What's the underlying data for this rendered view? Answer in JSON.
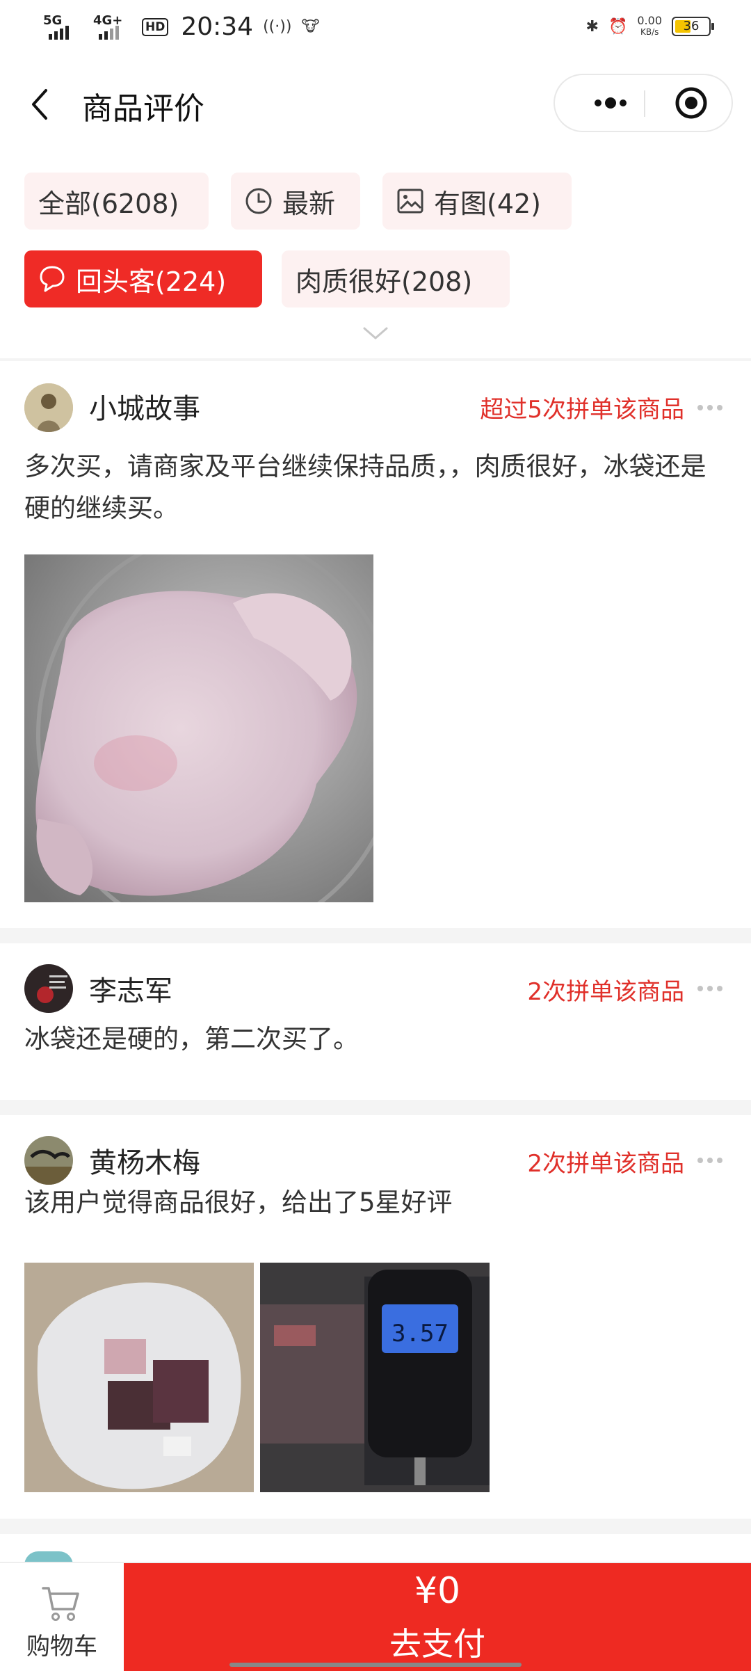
{
  "status_bar": {
    "net1": "5G",
    "net2": "4G+",
    "hd": "HD",
    "time": "20:34",
    "speed_value": "0.00",
    "speed_unit": "KB/s",
    "battery": "36"
  },
  "header": {
    "title": "商品评价"
  },
  "filters": {
    "all": "全部(6208)",
    "latest": "最新",
    "with_images": "有图(42)",
    "returning": "回头客(224)",
    "meat_quality": "肉质很好(208)"
  },
  "reviews": [
    {
      "username": "小城故事",
      "badge": "超过5次拼单该商品",
      "content": "多次买，请商家及平台继续保持品质，，肉质很好，冰袋还是硬的继续买。"
    },
    {
      "username": "李志军",
      "badge": "2次拼单该商品",
      "content": "冰袋还是硬的，第二次买了。"
    },
    {
      "username": "黄杨木梅",
      "badge": "2次拼单该商品",
      "content": "该用户觉得商品很好，给出了5星好评",
      "scale_reading": "3.57"
    }
  ],
  "bottom_bar": {
    "cart_label": "购物车",
    "pay_amount": "¥0",
    "pay_label": "去支付"
  },
  "colors": {
    "accent": "#ef2b26",
    "chip_bg": "#fdf1f1",
    "badge_text": "#e0302a"
  }
}
